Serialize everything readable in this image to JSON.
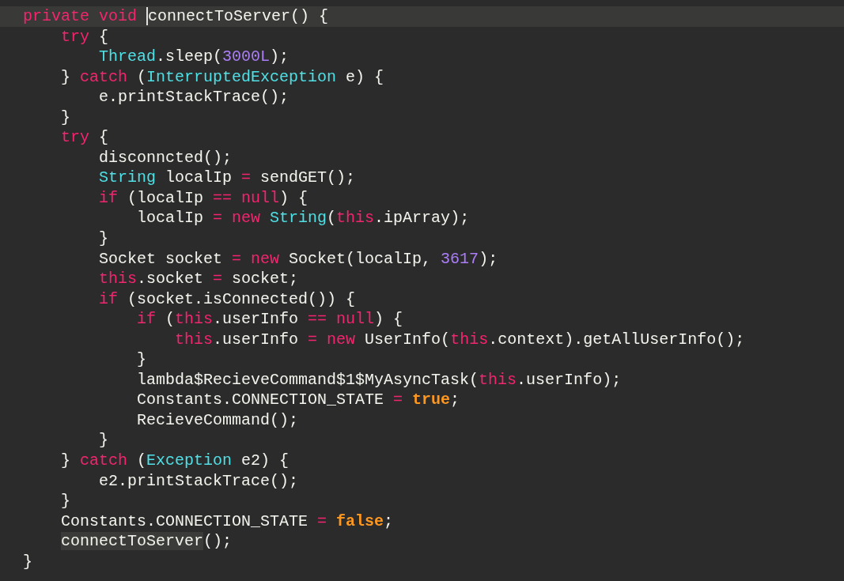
{
  "editor": {
    "lines": [
      {
        "current": true,
        "tokens": [
          {
            "kind": "keyword",
            "text": "private void "
          },
          {
            "kind": "plain",
            "text": "connectToServer",
            "caret_before": true
          },
          {
            "kind": "plain",
            "text": "() {"
          }
        ]
      },
      {
        "current": false,
        "tokens": [
          {
            "kind": "keyword",
            "text": "    try"
          },
          {
            "kind": "plain",
            "text": " {"
          }
        ]
      },
      {
        "current": false,
        "tokens": [
          {
            "kind": "type",
            "text": "        Thread"
          },
          {
            "kind": "plain",
            "text": ".sleep("
          },
          {
            "kind": "number",
            "text": "3000L"
          },
          {
            "kind": "plain",
            "text": ");"
          }
        ]
      },
      {
        "current": false,
        "tokens": [
          {
            "kind": "plain",
            "text": "    } "
          },
          {
            "kind": "keyword",
            "text": "catch"
          },
          {
            "kind": "plain",
            "text": " ("
          },
          {
            "kind": "type",
            "text": "InterruptedException"
          },
          {
            "kind": "plain",
            "text": " e) {"
          }
        ]
      },
      {
        "current": false,
        "tokens": [
          {
            "kind": "plain",
            "text": "        e.printStackTrace();"
          }
        ]
      },
      {
        "current": false,
        "tokens": [
          {
            "kind": "plain",
            "text": "    }"
          }
        ]
      },
      {
        "current": false,
        "tokens": [
          {
            "kind": "keyword",
            "text": "    try"
          },
          {
            "kind": "plain",
            "text": " {"
          }
        ]
      },
      {
        "current": false,
        "tokens": [
          {
            "kind": "plain",
            "text": "        disconncted();"
          }
        ]
      },
      {
        "current": false,
        "tokens": [
          {
            "kind": "type",
            "text": "        String"
          },
          {
            "kind": "plain",
            "text": " localIp "
          },
          {
            "kind": "keyword",
            "text": "="
          },
          {
            "kind": "plain",
            "text": " sendGET();"
          }
        ]
      },
      {
        "current": false,
        "tokens": [
          {
            "kind": "keyword",
            "text": "        if"
          },
          {
            "kind": "plain",
            "text": " (localIp "
          },
          {
            "kind": "keyword",
            "text": "== null"
          },
          {
            "kind": "plain",
            "text": ") {"
          }
        ]
      },
      {
        "current": false,
        "tokens": [
          {
            "kind": "plain",
            "text": "            localIp "
          },
          {
            "kind": "keyword",
            "text": "= new "
          },
          {
            "kind": "type",
            "text": "String"
          },
          {
            "kind": "plain",
            "text": "("
          },
          {
            "kind": "keyword",
            "text": "this"
          },
          {
            "kind": "plain",
            "text": ".ipArray);"
          }
        ]
      },
      {
        "current": false,
        "tokens": [
          {
            "kind": "plain",
            "text": "        }"
          }
        ]
      },
      {
        "current": false,
        "tokens": [
          {
            "kind": "plain",
            "text": "        Socket socket "
          },
          {
            "kind": "keyword",
            "text": "= new"
          },
          {
            "kind": "plain",
            "text": " Socket(localIp, "
          },
          {
            "kind": "number",
            "text": "3617"
          },
          {
            "kind": "plain",
            "text": ");"
          }
        ]
      },
      {
        "current": false,
        "tokens": [
          {
            "kind": "keyword",
            "text": "        this"
          },
          {
            "kind": "plain",
            "text": ".socket "
          },
          {
            "kind": "keyword",
            "text": "="
          },
          {
            "kind": "plain",
            "text": " socket;"
          }
        ]
      },
      {
        "current": false,
        "tokens": [
          {
            "kind": "keyword",
            "text": "        if"
          },
          {
            "kind": "plain",
            "text": " (socket.isConnected()) {"
          }
        ]
      },
      {
        "current": false,
        "tokens": [
          {
            "kind": "keyword",
            "text": "            if"
          },
          {
            "kind": "plain",
            "text": " ("
          },
          {
            "kind": "keyword",
            "text": "this"
          },
          {
            "kind": "plain",
            "text": ".userInfo "
          },
          {
            "kind": "keyword",
            "text": "== null"
          },
          {
            "kind": "plain",
            "text": ") {"
          }
        ]
      },
      {
        "current": false,
        "tokens": [
          {
            "kind": "keyword",
            "text": "                this"
          },
          {
            "kind": "plain",
            "text": ".userInfo "
          },
          {
            "kind": "keyword",
            "text": "= new"
          },
          {
            "kind": "plain",
            "text": " UserInfo("
          },
          {
            "kind": "keyword",
            "text": "this"
          },
          {
            "kind": "plain",
            "text": ".context).getAllUserInfo();"
          }
        ]
      },
      {
        "current": false,
        "tokens": [
          {
            "kind": "plain",
            "text": "            }"
          }
        ]
      },
      {
        "current": false,
        "tokens": [
          {
            "kind": "plain",
            "text": "            lambda$RecieveCommand$1$MyAsyncTask("
          },
          {
            "kind": "keyword",
            "text": "this"
          },
          {
            "kind": "plain",
            "text": ".userInfo);"
          }
        ]
      },
      {
        "current": false,
        "tokens": [
          {
            "kind": "plain",
            "text": "            Constants.CONNECTION_STATE "
          },
          {
            "kind": "keyword",
            "text": "= "
          },
          {
            "kind": "literal",
            "text": "true"
          },
          {
            "kind": "plain",
            "text": ";"
          }
        ]
      },
      {
        "current": false,
        "tokens": [
          {
            "kind": "plain",
            "text": "            RecieveCommand();"
          }
        ]
      },
      {
        "current": false,
        "tokens": [
          {
            "kind": "plain",
            "text": "        }"
          }
        ]
      },
      {
        "current": false,
        "tokens": [
          {
            "kind": "plain",
            "text": "    } "
          },
          {
            "kind": "keyword",
            "text": "catch"
          },
          {
            "kind": "plain",
            "text": " ("
          },
          {
            "kind": "type",
            "text": "Exception"
          },
          {
            "kind": "plain",
            "text": " e2) {"
          }
        ]
      },
      {
        "current": false,
        "tokens": [
          {
            "kind": "plain",
            "text": "        e2.printStackTrace();"
          }
        ]
      },
      {
        "current": false,
        "tokens": [
          {
            "kind": "plain",
            "text": "    }"
          }
        ]
      },
      {
        "current": false,
        "tokens": [
          {
            "kind": "plain",
            "text": "    Constants.CONNECTION_STATE "
          },
          {
            "kind": "keyword",
            "text": "= "
          },
          {
            "kind": "literal",
            "text": "false"
          },
          {
            "kind": "plain",
            "text": ";"
          }
        ]
      },
      {
        "current": false,
        "tokens": [
          {
            "kind": "match",
            "text": "    connectToServer"
          },
          {
            "kind": "plain",
            "text": "();"
          }
        ]
      },
      {
        "current": false,
        "tokens": [
          {
            "kind": "plain",
            "text": "}"
          }
        ]
      }
    ]
  }
}
